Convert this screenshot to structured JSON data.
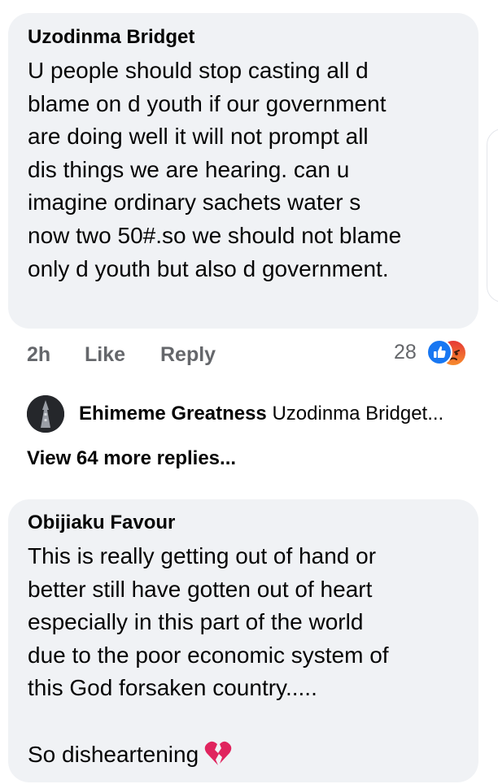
{
  "comments": [
    {
      "author": "Uzodinma Bridget",
      "lines": [
        "U people should stop casting all d",
        "blame on d youth if our government",
        "are doing well it will not prompt all",
        "dis things we are hearing. can u",
        "imagine ordinary sachets water s",
        "now two 50#.so we should not blame",
        "only d youth but also d government."
      ],
      "time": "2h",
      "like_label": "Like",
      "reply_label": "Reply",
      "reaction_count": "28",
      "reaction_icons": [
        "like-icon",
        "angry-icon"
      ]
    },
    {
      "author": "Obijiaku Favour",
      "lines": [
        "This is really getting out of hand or",
        "better still have gotten out of heart",
        "especially in this part of the world",
        "due to the poor economic system of",
        "this God forsaken country.....",
        "",
        "So disheartening"
      ],
      "emoji": "broken-heart-icon"
    }
  ],
  "reply_preview": {
    "name": "Ehimeme Greatness",
    "text": "Uzodinma Bridget..."
  },
  "view_more_label": "View 64 more replies...",
  "colors": {
    "bubble": "#f0f2f5",
    "secondary_text": "#65676b",
    "like_blue": "#1877f2",
    "angry_red": "#e53935",
    "heart_red": "#e0245e"
  }
}
